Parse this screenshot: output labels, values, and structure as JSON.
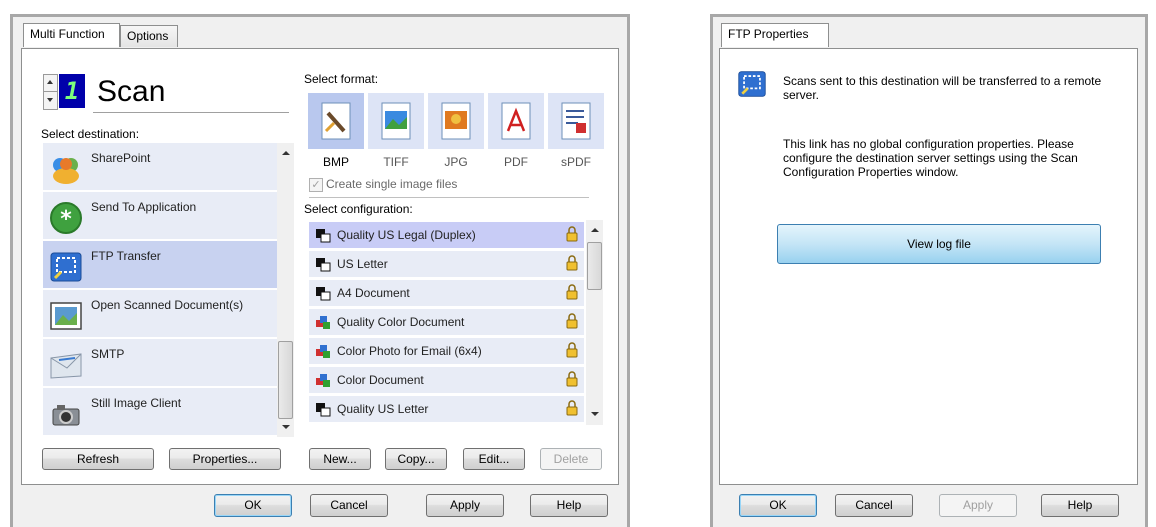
{
  "left_dialog": {
    "tabs": [
      "Multi Function",
      "Options"
    ],
    "scan_counter": "1",
    "scan_label": "Scan",
    "select_destination_label": "Select destination:",
    "destinations": [
      {
        "label": "SharePoint",
        "icon": "sharepoint-icon",
        "selected": false
      },
      {
        "label": "Send To Application",
        "icon": "send-to-application-icon",
        "selected": false
      },
      {
        "label": "FTP Transfer",
        "icon": "ftp-transfer-icon",
        "selected": true
      },
      {
        "label": "Open Scanned Document(s)",
        "icon": "open-scanned-document-icon",
        "selected": false
      },
      {
        "label": "SMTP",
        "icon": "smtp-icon",
        "selected": false
      },
      {
        "label": "Still Image Client",
        "icon": "still-image-client-icon",
        "selected": false
      }
    ],
    "refresh_label": "Refresh",
    "properties_label": "Properties...",
    "select_format_label": "Select format:",
    "formats": [
      {
        "label": "BMP",
        "selected": true
      },
      {
        "label": "TIFF",
        "selected": false
      },
      {
        "label": "JPG",
        "selected": false
      },
      {
        "label": "PDF",
        "selected": false
      },
      {
        "label": "sPDF",
        "selected": false
      }
    ],
    "create_single_image_label": "Create single image files",
    "select_configuration_label": "Select configuration:",
    "configurations": [
      {
        "label": "Quality US Legal (Duplex)",
        "kind": "bw",
        "selected": true
      },
      {
        "label": "US Letter",
        "kind": "bw",
        "selected": false
      },
      {
        "label": "A4 Document",
        "kind": "bw",
        "selected": false
      },
      {
        "label": "Quality Color Document",
        "kind": "color",
        "selected": false
      },
      {
        "label": "Color Photo for Email (6x4)",
        "kind": "color",
        "selected": false
      },
      {
        "label": "Color Document",
        "kind": "color",
        "selected": false
      },
      {
        "label": "Quality US Letter",
        "kind": "bw",
        "selected": false
      }
    ],
    "new_label": "New...",
    "copy_label": "Copy...",
    "edit_label": "Edit...",
    "delete_label": "Delete",
    "ok_label": "OK",
    "cancel_label": "Cancel",
    "apply_label": "Apply",
    "help_label": "Help"
  },
  "right_dialog": {
    "tab": "FTP Properties",
    "description": "Scans sent to this destination will be transferred to a remote server.",
    "info": "This link has no global configuration properties. Please configure the destination server settings using the Scan Configuration Properties window.",
    "view_log_label": "View log file",
    "ok_label": "OK",
    "cancel_label": "Cancel",
    "apply_label": "Apply",
    "help_label": "Help"
  },
  "colors": {
    "selection": "#c8d2f0",
    "list_item": "#e8ecf6",
    "view_log_button": "#bfe3f7"
  }
}
